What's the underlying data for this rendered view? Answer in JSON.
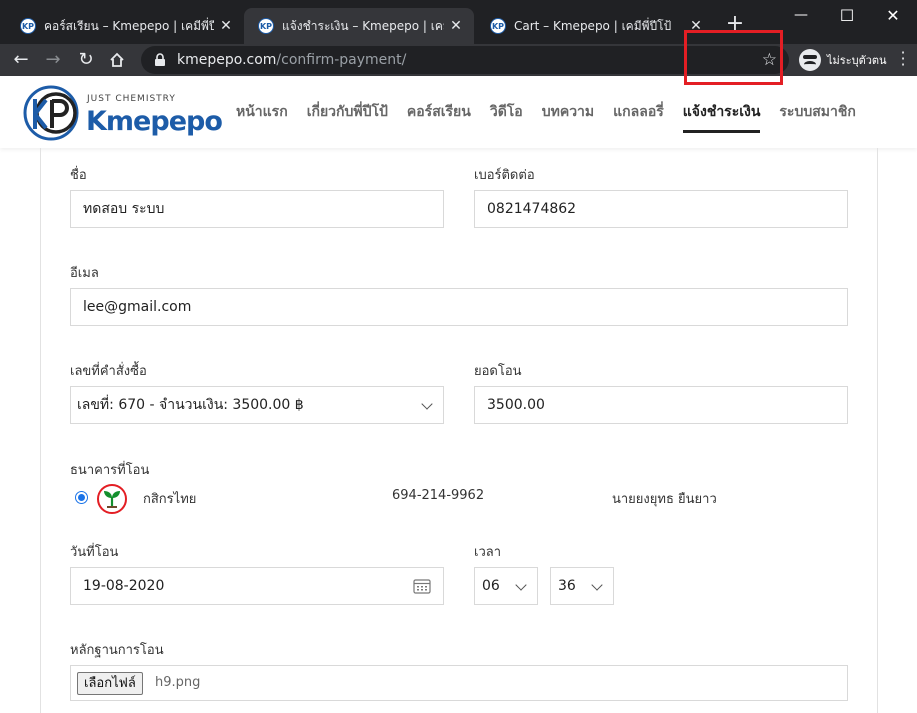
{
  "browser": {
    "tabs": [
      {
        "title": "คอร์สเรียน – Kmepepo | เคมีพี่ปีโป้",
        "active": false
      },
      {
        "title": "แจ้งชำระเงิน – Kmepepo | เคมีพี่ปีโป้",
        "active": true
      },
      {
        "title": "Cart – Kmepepo | เคมีพี่ปีโป้",
        "active": false
      }
    ],
    "favicon_text": "KP",
    "url_domain": "kmepepo.com",
    "url_path": "/confirm-payment/",
    "incognito_label": "ไม่ระบุตัวตน",
    "window_controls": {
      "minimize": "—",
      "maximize": "☐",
      "close": "✕"
    }
  },
  "site": {
    "logo": {
      "tagline": "JUST CHEMISTRY",
      "name": "Kmepepo"
    },
    "nav": [
      "หน้าแรก",
      "เกี่ยวกับพี่ปีโป้",
      "คอร์สเรียน",
      "วิดีโอ",
      "บทความ",
      "แกลลอรี่",
      "แจ้งชำระเงิน",
      "ระบบสมาชิก"
    ],
    "active_nav": "แจ้งชำระเงิน",
    "highlight_color": "#e31e24"
  },
  "form": {
    "name": {
      "label": "ชื่อ",
      "value": "ทดสอบ ระบบ"
    },
    "phone": {
      "label": "เบอร์ติดต่อ",
      "value": "0821474862"
    },
    "email": {
      "label": "อีเมล",
      "value": "lee@gmail.com"
    },
    "order": {
      "label": "เลขที่คำสั่งซื้อ",
      "value": "เลขที่: 670 - จำนวนเงิน: 3500.00 ฿"
    },
    "amount": {
      "label": "ยอดโอน",
      "value": "3500.00"
    },
    "bank": {
      "label": "ธนาคารที่โอน",
      "name": "กสิกรไทย",
      "account_number": "694-214-9962",
      "account_name": "นายยงยุทธ ยืนยาว",
      "selected": true,
      "brand_color": "#138f2d"
    },
    "date": {
      "label": "วันที่โอน",
      "value": "19-08-2020"
    },
    "time": {
      "label": "เวลา",
      "hour": "06",
      "minute": "36"
    },
    "proof": {
      "label": "หลักฐานการโอน",
      "button": "เลือกไฟล์",
      "file_name": "h9.png"
    }
  }
}
